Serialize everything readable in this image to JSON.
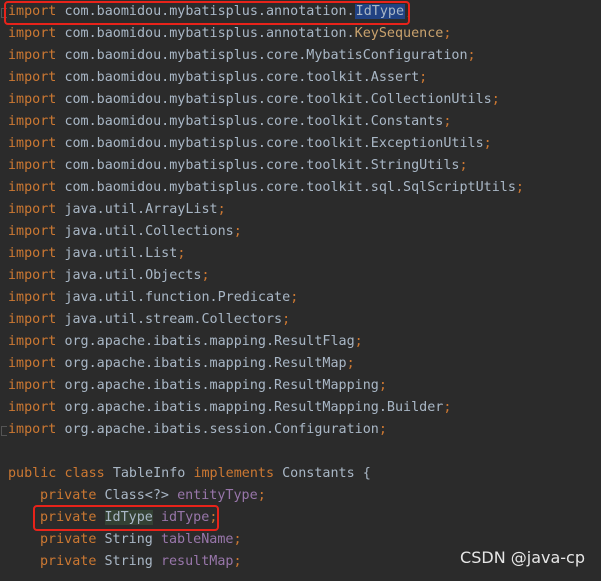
{
  "code": {
    "imports": [
      {
        "kw": "import",
        "pkg": "com.baomidou.mybatisplus.annotation.",
        "cls": "IdType",
        "semi": ";"
      },
      {
        "kw": "import",
        "pkg": "com.baomidou.mybatisplus.annotation.",
        "cls": "KeySequence",
        "semi": ";"
      },
      {
        "kw": "import",
        "pkg": "com.baomidou.mybatisplus.core.",
        "cls": "MybatisConfiguration",
        "semi": ";"
      },
      {
        "kw": "import",
        "pkg": "com.baomidou.mybatisplus.core.toolkit.",
        "cls": "Assert",
        "semi": ";"
      },
      {
        "kw": "import",
        "pkg": "com.baomidou.mybatisplus.core.toolkit.",
        "cls": "CollectionUtils",
        "semi": ";"
      },
      {
        "kw": "import",
        "pkg": "com.baomidou.mybatisplus.core.toolkit.",
        "cls": "Constants",
        "semi": ";"
      },
      {
        "kw": "import",
        "pkg": "com.baomidou.mybatisplus.core.toolkit.",
        "cls": "ExceptionUtils",
        "semi": ";"
      },
      {
        "kw": "import",
        "pkg": "com.baomidou.mybatisplus.core.toolkit.",
        "cls": "StringUtils",
        "semi": ";"
      },
      {
        "kw": "import",
        "pkg": "com.baomidou.mybatisplus.core.toolkit.sql.",
        "cls": "SqlScriptUtils",
        "semi": ";"
      },
      {
        "kw": "import",
        "pkg": "java.util.",
        "cls": "ArrayList",
        "semi": ";"
      },
      {
        "kw": "import",
        "pkg": "java.util.",
        "cls": "Collections",
        "semi": ";"
      },
      {
        "kw": "import",
        "pkg": "java.util.",
        "cls": "List",
        "semi": ";"
      },
      {
        "kw": "import",
        "pkg": "java.util.",
        "cls": "Objects",
        "semi": ";"
      },
      {
        "kw": "import",
        "pkg": "java.util.function.",
        "cls": "Predicate",
        "semi": ";"
      },
      {
        "kw": "import",
        "pkg": "java.util.stream.",
        "cls": "Collectors",
        "semi": ";"
      },
      {
        "kw": "import",
        "pkg": "org.apache.ibatis.mapping.",
        "cls": "ResultFlag",
        "semi": ";"
      },
      {
        "kw": "import",
        "pkg": "org.apache.ibatis.mapping.",
        "cls": "ResultMap",
        "semi": ";"
      },
      {
        "kw": "import",
        "pkg": "org.apache.ibatis.mapping.",
        "cls": "ResultMapping",
        "semi": ";"
      },
      {
        "kw": "import",
        "pkg": "org.apache.ibatis.mapping.",
        "cls": "ResultMapping.Builder",
        "semi": ";"
      },
      {
        "kw": "import",
        "pkg": "org.apache.ibatis.session.",
        "cls": "Configuration",
        "semi": ";"
      }
    ],
    "class_decl": {
      "kw1": "public",
      "kw2": "class",
      "name": "TableInfo",
      "kw3": "implements",
      "iface": "Constants",
      "brace": "{"
    },
    "fields": [
      {
        "kw": "private",
        "type": "Class<?>",
        "name": "entityType",
        "semi": ";"
      },
      {
        "kw": "private",
        "type": "IdType",
        "name": "idType",
        "semi": ";"
      },
      {
        "kw": "private",
        "type": "String",
        "name": "tableName",
        "semi": ";"
      },
      {
        "kw": "private",
        "type": "String",
        "name": "resultMap",
        "semi": ";"
      }
    ]
  },
  "watermark": "CSDN @java-cp",
  "colors": {
    "background": "#2b2b2b",
    "keyword": "#cc7832",
    "text": "#a9b7c6",
    "field": "#9876aa",
    "highlight_box": "#e8231a",
    "selection": "#214283"
  }
}
